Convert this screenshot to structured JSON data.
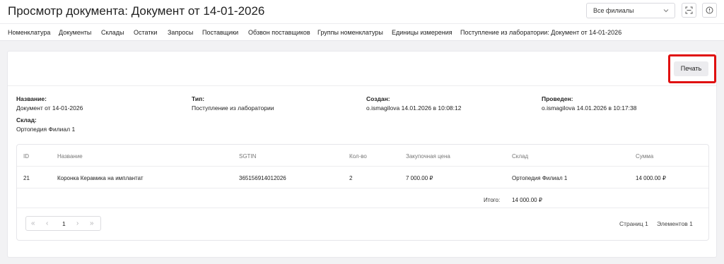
{
  "header": {
    "title": "Просмотр документа: Документ от 14-01-2026",
    "branch_select": "Все филиалы"
  },
  "nav": {
    "items": [
      "Номенклатура",
      "Документы",
      "Склады",
      "Остатки",
      "Запросы",
      "Поставщики",
      "Обзвон поставщиков",
      "Группы номенклатуры",
      "Единицы измерения",
      "Поступление из лаборатории: Документ от 14-01-2026"
    ]
  },
  "toolbar": {
    "print_label": "Печать"
  },
  "info": {
    "name_label": "Название:",
    "name_value": "Документ от 14-01-2026",
    "type_label": "Тип:",
    "type_value": "Поступление из лаборатории",
    "created_label": "Создан:",
    "created_value": "o.ismagilova 14.01.2026 в 10:08:12",
    "posted_label": "Проведен:",
    "posted_value": "o.ismagilova 14.01.2026 в 10:17:38",
    "warehouse_label": "Склад:",
    "warehouse_value": "Ортопедия Филиал 1"
  },
  "table": {
    "columns": [
      "ID",
      "Название",
      "SGTIN",
      "Кол-во",
      "Закупочная цена",
      "Склад",
      "Сумма"
    ],
    "rows": [
      [
        "21",
        "Коронка Керамика на имплантат",
        "365156914012026",
        "2",
        "7 000.00 ₽",
        "Ортопедия Филиал 1",
        "14 000.00 ₽"
      ]
    ],
    "total_label": "Итого:",
    "total_value": "14 000.00 ₽"
  },
  "pagination": {
    "current_page": "1",
    "pages_label": "Страниц 1",
    "items_label": "Элементов 1"
  },
  "colors": {
    "highlight": "#e01010",
    "background": "#f2f2f4"
  }
}
